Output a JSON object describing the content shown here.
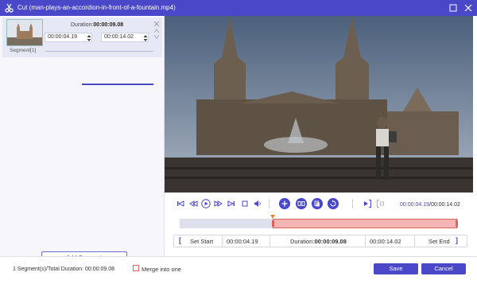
{
  "window": {
    "title": "Cut (man-plays-an-accordion-in-front-of-a-fountain.mp4)",
    "accent": "#4a48c8"
  },
  "segment_card": {
    "duration_label": "Duration:",
    "duration_value": "00:00:09.08",
    "start_time": "00:00:04.19",
    "end_time": "00:00:14.02",
    "segment_label": "Segment[1]"
  },
  "sidebar": {
    "add_segment": "Add Segment"
  },
  "player": {
    "current_time": "00:00:04.19",
    "separator": "/",
    "total_time": "00:00:14.02"
  },
  "timeline": {
    "selection_start_fraction": 0.299,
    "selection_end_fraction": 1.0,
    "selection_color": "#f7b4b4"
  },
  "cut_bar": {
    "set_start": "Set Start",
    "start_time": "00:00:04.19",
    "duration_label": "Duration:",
    "duration_value": "00:00:09.08",
    "end_time": "00:00:14.02",
    "set_end": "Set End"
  },
  "footer": {
    "summary": "1 Segment(s)/Total Duration: 00:00:09.08",
    "merge_label": "Merge into one",
    "save": "Save",
    "cancel": "Cancel"
  }
}
